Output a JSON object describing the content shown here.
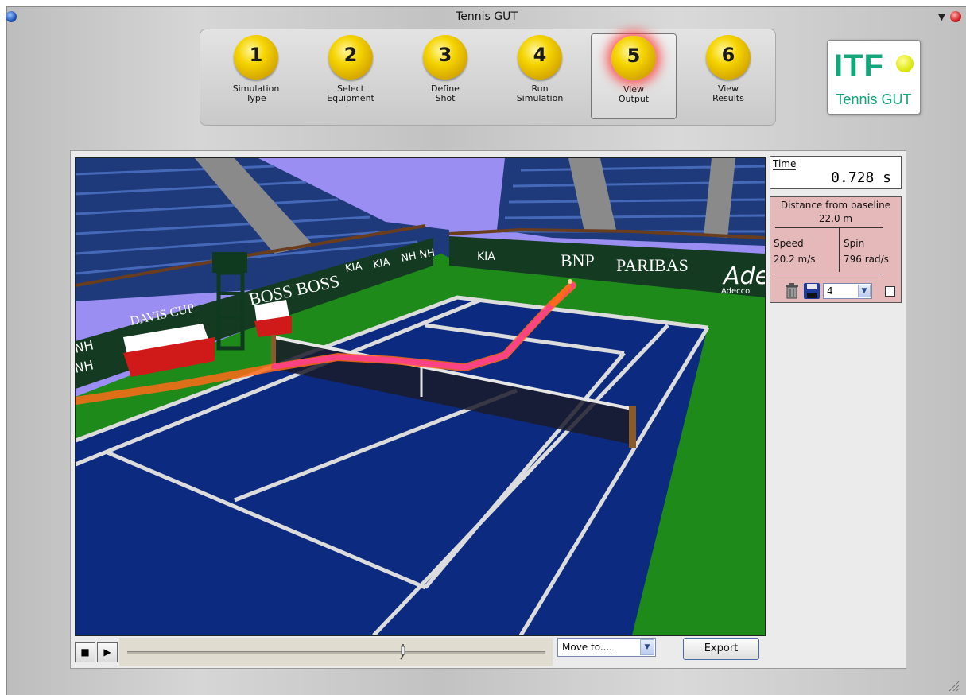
{
  "window": {
    "title": "Tennis GUT"
  },
  "steps": [
    {
      "number": "1",
      "label_line1": "Simulation",
      "label_line2": "Type"
    },
    {
      "number": "2",
      "label_line1": "Select",
      "label_line2": "Equipment"
    },
    {
      "number": "3",
      "label_line1": "Define",
      "label_line2": "Shot"
    },
    {
      "number": "4",
      "label_line1": "Run",
      "label_line2": "Simulation"
    },
    {
      "number": "5",
      "label_line1": "View",
      "label_line2": "Output",
      "active": true
    },
    {
      "number": "6",
      "label_line1": "View",
      "label_line2": "Results"
    }
  ],
  "logo": {
    "word": "ITF",
    "subtitle": "Tennis GUT",
    "color": "#12a77a"
  },
  "scene": {
    "banners": [
      "DAVIS CUP",
      "BNP PARIBAS",
      "BOSS BOSS",
      "BNP",
      "PARIBAS",
      "Ade",
      "Adecco",
      "KIA",
      "KIA",
      "KIA",
      "NH NH",
      "NH",
      "NH"
    ],
    "court_color": "#0c2a80",
    "surround_color": "#1e8a1a",
    "sky_color": "#9a8ef2",
    "trajectory_colors": [
      "#ff6a1a",
      "#ff3f8c"
    ]
  },
  "readout": {
    "time_label": "Time",
    "time_value": "0.728 s",
    "distance_label": "Distance from baseline",
    "distance_value": "22.0 m",
    "speed_label": "Speed",
    "speed_value": "20.2 m/s",
    "spin_label": "Spin",
    "spin_value": "796 rad/s",
    "count_value": "4",
    "overlay_checked": false
  },
  "playback": {
    "stop_glyph": "■",
    "play_glyph": "▶",
    "position": 0.66,
    "moveto_value": "Move to....",
    "export_label": "Export"
  }
}
